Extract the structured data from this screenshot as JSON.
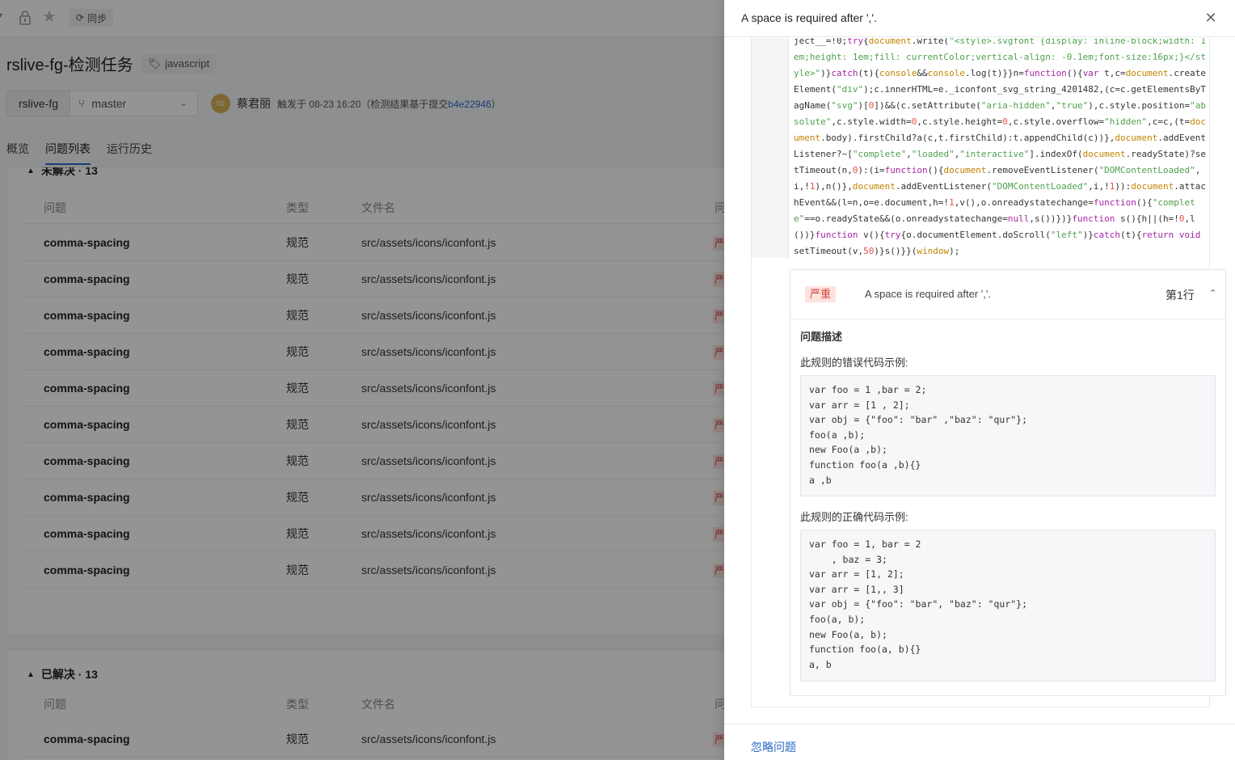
{
  "topbar": {
    "sync_label": "同步"
  },
  "task": {
    "repo": "rslive-fg",
    "title": "rslive-fg-检测任务",
    "language": "javascript",
    "branch": "master"
  },
  "trigger": {
    "avatar_initials": "01",
    "user": "蔡君丽",
    "text": "触发于 08-23 16:20（检测结果基于提交",
    "commit": "b4e22946",
    "suffix": "）"
  },
  "tabs": [
    "概览",
    "问题列表",
    "运行历史"
  ],
  "unresolved": {
    "header_partial": "未解决 · 13",
    "columns": [
      "问题",
      "类型",
      "文件名",
      "问"
    ],
    "rows": [
      {
        "rule": "comma-spacing",
        "type": "规范",
        "file": "src/assets/icons/iconfont.js",
        "sev": "严"
      },
      {
        "rule": "comma-spacing",
        "type": "规范",
        "file": "src/assets/icons/iconfont.js",
        "sev": "严"
      },
      {
        "rule": "comma-spacing",
        "type": "规范",
        "file": "src/assets/icons/iconfont.js",
        "sev": "严"
      },
      {
        "rule": "comma-spacing",
        "type": "规范",
        "file": "src/assets/icons/iconfont.js",
        "sev": "严"
      },
      {
        "rule": "comma-spacing",
        "type": "规范",
        "file": "src/assets/icons/iconfont.js",
        "sev": "严"
      },
      {
        "rule": "comma-spacing",
        "type": "规范",
        "file": "src/assets/icons/iconfont.js",
        "sev": "严"
      },
      {
        "rule": "comma-spacing",
        "type": "规范",
        "file": "src/assets/icons/iconfont.js",
        "sev": "严"
      },
      {
        "rule": "comma-spacing",
        "type": "规范",
        "file": "src/assets/icons/iconfont.js",
        "sev": "严"
      },
      {
        "rule": "comma-spacing",
        "type": "规范",
        "file": "src/assets/icons/iconfont.js",
        "sev": "严"
      },
      {
        "rule": "comma-spacing",
        "type": "规范",
        "file": "src/assets/icons/iconfont.js",
        "sev": "严"
      }
    ]
  },
  "resolved": {
    "header": "已解决 · 13",
    "columns": [
      "问题",
      "类型",
      "文件名",
      "问"
    ],
    "rows": [
      {
        "rule": "comma-spacing",
        "type": "规范",
        "file": "src/assets/icons/iconfont.js",
        "sev": "严"
      }
    ]
  },
  "drawer": {
    "title": "A space is required after ','.",
    "issue": {
      "severity": "严重",
      "message": "A space is required after ','.",
      "line": "第1行",
      "desc_title": "问题描述",
      "bad_label": "此规则的错误代码示例:",
      "bad_code": "var foo = 1 ,bar = 2;\nvar arr = [1 , 2];\nvar obj = {\"foo\": \"bar\" ,\"baz\": \"qur\"};\nfoo(a ,b);\nnew Foo(a ,b);\nfunction foo(a ,b){}\na ,b",
      "good_label": "此规则的正确代码示例:",
      "good_code": "var foo = 1, bar = 2\n    , baz = 3;\nvar arr = [1, 2];\nvar arr = [1,, 3]\nvar obj = {\"foo\": \"bar\", \"baz\": \"qur\"};\nfoo(a, b);\nnew Foo(a, b);\nfunction foo(a, b){}\na, b"
    },
    "ignore_label": "忽略问题"
  }
}
